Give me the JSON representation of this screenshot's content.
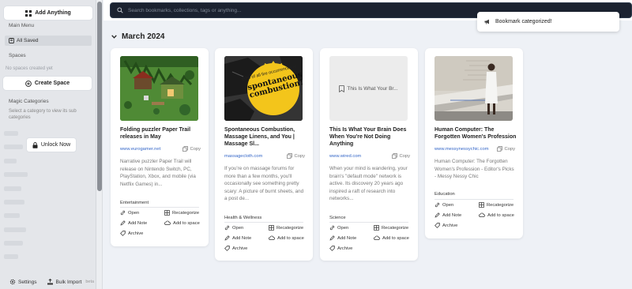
{
  "sidebar": {
    "add_anything": "Add Anything",
    "main_menu": "Main Menu",
    "all_saved": "All Saved",
    "spaces": "Spaces",
    "no_spaces": "No spaces created yet",
    "create_space": "Create Space",
    "magic_categories": "Magic Categories",
    "magic_hint": "Select a category to view its sub categories",
    "unlock_now": "Unlock Now",
    "settings": "Settings",
    "bulk_import": "Bulk Import",
    "beta": "beta"
  },
  "search": {
    "placeholder": "Search bookmarks, collections, tags or anything..."
  },
  "toast": {
    "message": "Bookmark categorized!"
  },
  "main": {
    "month": "March 2024"
  },
  "actions": {
    "open": "Open",
    "recategorize": "Recategorize",
    "add_note": "Add Note",
    "add_to_space": "Add to space",
    "archive": "Archive",
    "copy": "Copy"
  },
  "cards": [
    {
      "title": "Folding puzzler Paper Trail releases in May",
      "url": "www.eurogamer.net",
      "description": "Narrative puzzler Paper Trail will release on Nintendo Switch, PC, PlayStation, Xbox, and mobile (via Netflix Games) in...",
      "category": "Entertainment"
    },
    {
      "title": "Spontaneous Combustion, Massage Linens, and You | Massage Sl...",
      "url": "massagecloth.com",
      "description": "If you're on massage forums for more than a few months, you'll occasionally see something pretty scary: A picture of burnt sheets, and a post de...",
      "category": "Health & Wellness",
      "sticker_top": "80% of all fire occurrences at",
      "sticker_main": "spontaneous combustion!"
    },
    {
      "title": "This Is What Your Brain Does When You're Not Doing Anything",
      "url": "www.wired.com",
      "description": "When your mind is wandering, your brain's \"default mode\" network is active. Its discovery 20 years ago inspired a raft of research into networks...",
      "category": "Science",
      "placeholder_text": "This Is What Your Br..."
    },
    {
      "title": "Human Computer: The Forgotten Women's Profession",
      "url": "www.messynessychic.com",
      "description": "Human Computer: The Forgotten Women's Profession - Editor's Picks - Messy Nessy Chic",
      "category": "Education"
    }
  ]
}
